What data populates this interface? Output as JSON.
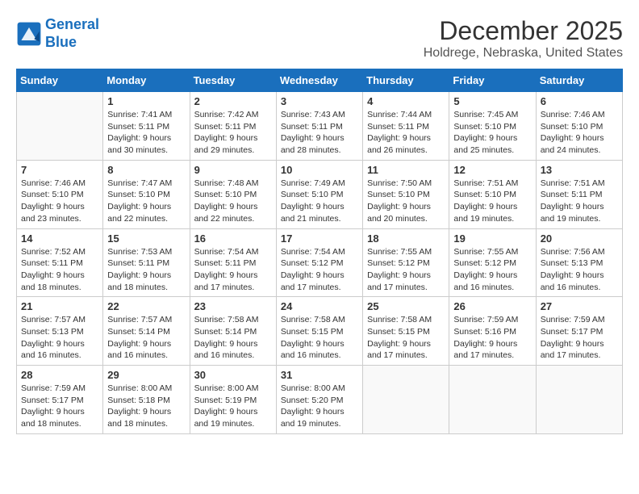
{
  "logo": {
    "line1": "General",
    "line2": "Blue"
  },
  "title": "December 2025",
  "location": "Holdrege, Nebraska, United States",
  "days_of_week": [
    "Sunday",
    "Monday",
    "Tuesday",
    "Wednesday",
    "Thursday",
    "Friday",
    "Saturday"
  ],
  "weeks": [
    [
      {
        "day": "",
        "sunrise": "",
        "sunset": "",
        "daylight": ""
      },
      {
        "day": "1",
        "sunrise": "Sunrise: 7:41 AM",
        "sunset": "Sunset: 5:11 PM",
        "daylight": "Daylight: 9 hours and 30 minutes."
      },
      {
        "day": "2",
        "sunrise": "Sunrise: 7:42 AM",
        "sunset": "Sunset: 5:11 PM",
        "daylight": "Daylight: 9 hours and 29 minutes."
      },
      {
        "day": "3",
        "sunrise": "Sunrise: 7:43 AM",
        "sunset": "Sunset: 5:11 PM",
        "daylight": "Daylight: 9 hours and 28 minutes."
      },
      {
        "day": "4",
        "sunrise": "Sunrise: 7:44 AM",
        "sunset": "Sunset: 5:11 PM",
        "daylight": "Daylight: 9 hours and 26 minutes."
      },
      {
        "day": "5",
        "sunrise": "Sunrise: 7:45 AM",
        "sunset": "Sunset: 5:10 PM",
        "daylight": "Daylight: 9 hours and 25 minutes."
      },
      {
        "day": "6",
        "sunrise": "Sunrise: 7:46 AM",
        "sunset": "Sunset: 5:10 PM",
        "daylight": "Daylight: 9 hours and 24 minutes."
      }
    ],
    [
      {
        "day": "7",
        "sunrise": "Sunrise: 7:46 AM",
        "sunset": "Sunset: 5:10 PM",
        "daylight": "Daylight: 9 hours and 23 minutes."
      },
      {
        "day": "8",
        "sunrise": "Sunrise: 7:47 AM",
        "sunset": "Sunset: 5:10 PM",
        "daylight": "Daylight: 9 hours and 22 minutes."
      },
      {
        "day": "9",
        "sunrise": "Sunrise: 7:48 AM",
        "sunset": "Sunset: 5:10 PM",
        "daylight": "Daylight: 9 hours and 22 minutes."
      },
      {
        "day": "10",
        "sunrise": "Sunrise: 7:49 AM",
        "sunset": "Sunset: 5:10 PM",
        "daylight": "Daylight: 9 hours and 21 minutes."
      },
      {
        "day": "11",
        "sunrise": "Sunrise: 7:50 AM",
        "sunset": "Sunset: 5:10 PM",
        "daylight": "Daylight: 9 hours and 20 minutes."
      },
      {
        "day": "12",
        "sunrise": "Sunrise: 7:51 AM",
        "sunset": "Sunset: 5:10 PM",
        "daylight": "Daylight: 9 hours and 19 minutes."
      },
      {
        "day": "13",
        "sunrise": "Sunrise: 7:51 AM",
        "sunset": "Sunset: 5:11 PM",
        "daylight": "Daylight: 9 hours and 19 minutes."
      }
    ],
    [
      {
        "day": "14",
        "sunrise": "Sunrise: 7:52 AM",
        "sunset": "Sunset: 5:11 PM",
        "daylight": "Daylight: 9 hours and 18 minutes."
      },
      {
        "day": "15",
        "sunrise": "Sunrise: 7:53 AM",
        "sunset": "Sunset: 5:11 PM",
        "daylight": "Daylight: 9 hours and 18 minutes."
      },
      {
        "day": "16",
        "sunrise": "Sunrise: 7:54 AM",
        "sunset": "Sunset: 5:11 PM",
        "daylight": "Daylight: 9 hours and 17 minutes."
      },
      {
        "day": "17",
        "sunrise": "Sunrise: 7:54 AM",
        "sunset": "Sunset: 5:12 PM",
        "daylight": "Daylight: 9 hours and 17 minutes."
      },
      {
        "day": "18",
        "sunrise": "Sunrise: 7:55 AM",
        "sunset": "Sunset: 5:12 PM",
        "daylight": "Daylight: 9 hours and 17 minutes."
      },
      {
        "day": "19",
        "sunrise": "Sunrise: 7:55 AM",
        "sunset": "Sunset: 5:12 PM",
        "daylight": "Daylight: 9 hours and 16 minutes."
      },
      {
        "day": "20",
        "sunrise": "Sunrise: 7:56 AM",
        "sunset": "Sunset: 5:13 PM",
        "daylight": "Daylight: 9 hours and 16 minutes."
      }
    ],
    [
      {
        "day": "21",
        "sunrise": "Sunrise: 7:57 AM",
        "sunset": "Sunset: 5:13 PM",
        "daylight": "Daylight: 9 hours and 16 minutes."
      },
      {
        "day": "22",
        "sunrise": "Sunrise: 7:57 AM",
        "sunset": "Sunset: 5:14 PM",
        "daylight": "Daylight: 9 hours and 16 minutes."
      },
      {
        "day": "23",
        "sunrise": "Sunrise: 7:58 AM",
        "sunset": "Sunset: 5:14 PM",
        "daylight": "Daylight: 9 hours and 16 minutes."
      },
      {
        "day": "24",
        "sunrise": "Sunrise: 7:58 AM",
        "sunset": "Sunset: 5:15 PM",
        "daylight": "Daylight: 9 hours and 16 minutes."
      },
      {
        "day": "25",
        "sunrise": "Sunrise: 7:58 AM",
        "sunset": "Sunset: 5:15 PM",
        "daylight": "Daylight: 9 hours and 17 minutes."
      },
      {
        "day": "26",
        "sunrise": "Sunrise: 7:59 AM",
        "sunset": "Sunset: 5:16 PM",
        "daylight": "Daylight: 9 hours and 17 minutes."
      },
      {
        "day": "27",
        "sunrise": "Sunrise: 7:59 AM",
        "sunset": "Sunset: 5:17 PM",
        "daylight": "Daylight: 9 hours and 17 minutes."
      }
    ],
    [
      {
        "day": "28",
        "sunrise": "Sunrise: 7:59 AM",
        "sunset": "Sunset: 5:17 PM",
        "daylight": "Daylight: 9 hours and 18 minutes."
      },
      {
        "day": "29",
        "sunrise": "Sunrise: 8:00 AM",
        "sunset": "Sunset: 5:18 PM",
        "daylight": "Daylight: 9 hours and 18 minutes."
      },
      {
        "day": "30",
        "sunrise": "Sunrise: 8:00 AM",
        "sunset": "Sunset: 5:19 PM",
        "daylight": "Daylight: 9 hours and 19 minutes."
      },
      {
        "day": "31",
        "sunrise": "Sunrise: 8:00 AM",
        "sunset": "Sunset: 5:20 PM",
        "daylight": "Daylight: 9 hours and 19 minutes."
      },
      {
        "day": "",
        "sunrise": "",
        "sunset": "",
        "daylight": ""
      },
      {
        "day": "",
        "sunrise": "",
        "sunset": "",
        "daylight": ""
      },
      {
        "day": "",
        "sunrise": "",
        "sunset": "",
        "daylight": ""
      }
    ]
  ]
}
